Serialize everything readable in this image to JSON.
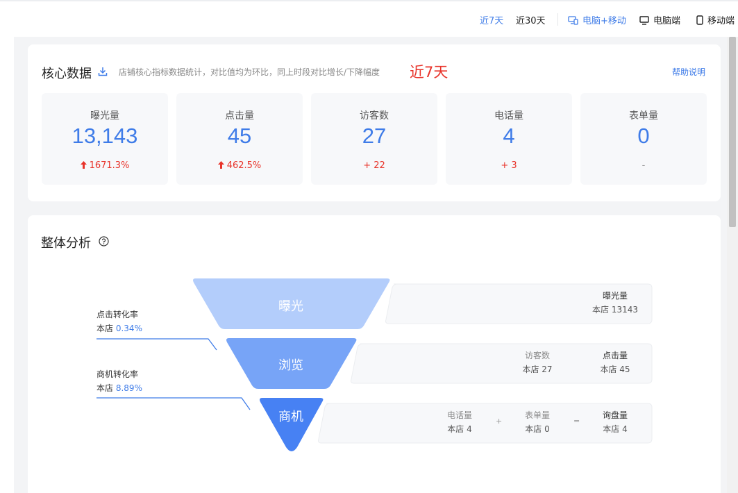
{
  "topbar": {
    "period_7": "近7天",
    "period_30": "近30天",
    "device_all": "电脑+移动",
    "device_pc": "电脑端",
    "device_mobile": "移动端"
  },
  "core": {
    "title": "核心数据",
    "subtitle": "店铺核心指标数据统计，对比值均为环比，同上时段对比增长/下降幅度",
    "period": "近7天",
    "help": "帮助说明",
    "metrics": [
      {
        "label": "曝光量",
        "value": "13,143",
        "delta": "1671.3%"
      },
      {
        "label": "点击量",
        "value": "45",
        "delta": "462.5%"
      },
      {
        "label": "访客数",
        "value": "27",
        "delta": "+ 22"
      },
      {
        "label": "电话量",
        "value": "4",
        "delta": "+ 3"
      },
      {
        "label": "表单量",
        "value": "0",
        "delta": "-"
      }
    ]
  },
  "analysis": {
    "title": "整体分析",
    "rates": [
      {
        "label": "点击转化率",
        "prefix": "本店",
        "value": "0.34%"
      },
      {
        "label": "商机转化率",
        "prefix": "本店",
        "value": "8.89%"
      }
    ],
    "stages": [
      "曝光",
      "浏览",
      "商机"
    ],
    "stats": {
      "exposure": {
        "label": "曝光量",
        "value": "本店 13143"
      },
      "visitors": {
        "label": "访客数",
        "value": "本店 27"
      },
      "clicks": {
        "label": "点击量",
        "value": "本店 45"
      },
      "calls": {
        "label": "电话量",
        "value": "本店 4"
      },
      "forms": {
        "label": "表单量",
        "value": "本店 0"
      },
      "inquiries": {
        "label": "询盘量",
        "value": "本店 4"
      },
      "plus": "+",
      "equals": "="
    },
    "colors": {
      "stage1": "#b3cdfb",
      "stage2": "#77a4f7",
      "stage3": "#4781f3"
    }
  }
}
